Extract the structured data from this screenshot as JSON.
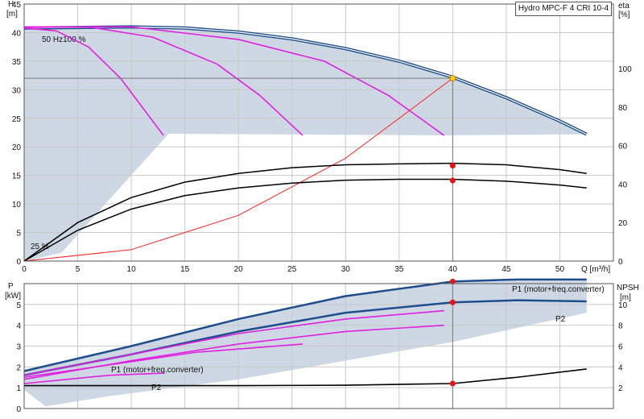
{
  "chart_data": [
    {
      "type": "line",
      "title": "Hydro MPC-F 4 CRI 10-4",
      "xlabel": "Q [m³/h]",
      "ylabel_unit": "H",
      "ylabel_bracket": "[m]",
      "y2label_unit": "eta",
      "y2label_bracket": "[%]",
      "xlim": [
        0,
        55
      ],
      "ylim": [
        0,
        45
      ],
      "y2lim": [
        0,
        133.5
      ],
      "x_ticks": [
        0,
        5,
        10,
        15,
        20,
        25,
        30,
        35,
        40,
        45,
        50
      ],
      "y_ticks": [
        0,
        5,
        10,
        15,
        20,
        25,
        30,
        35,
        40,
        45
      ],
      "y2_ticks": [
        0,
        20,
        40,
        60,
        80,
        100
      ],
      "grid": true,
      "annotations": [
        "50 Hz100 %",
        "25 %"
      ],
      "duty_point": {
        "x": 40,
        "y": 32
      },
      "series": [
        {
          "color": "#1f4e8c",
          "x": [
            0,
            5,
            10,
            15,
            20,
            25,
            30,
            35,
            40,
            45,
            50,
            52.5
          ],
          "y": [
            40.8,
            40.9,
            41,
            40.8,
            40.1,
            38.9,
            37.2,
            35,
            32.2,
            28.6,
            24.5,
            22.2
          ]
        },
        {
          "color": "#e020e0",
          "x": [
            0,
            3,
            6,
            9,
            11,
            13
          ],
          "y": [
            40.8,
            40.3,
            37.5,
            32,
            27,
            22
          ]
        },
        {
          "color": "#e020e0",
          "x": [
            0,
            6,
            12,
            18,
            22,
            26
          ],
          "y": [
            40.9,
            41,
            39.2,
            34.5,
            29,
            22
          ]
        },
        {
          "color": "#e020e0",
          "x": [
            0,
            10,
            20,
            28,
            34,
            39.2
          ],
          "y": [
            41,
            41,
            38.8,
            35,
            29,
            22
          ]
        },
        {
          "color": "#ff2020",
          "x": [
            0,
            10,
            20,
            30,
            40
          ],
          "y": [
            0,
            2,
            8,
            18,
            32
          ]
        },
        {
          "color": "#000000",
          "x": [
            0,
            5,
            10,
            15,
            20,
            25,
            30,
            35,
            40,
            45,
            50,
            52.5
          ],
          "y": [
            0,
            20,
            33,
            41,
            45.5,
            48.5,
            50,
            50.5,
            50.8,
            50,
            47.5,
            45.5
          ]
        },
        {
          "color": "#000000",
          "x": [
            0,
            5,
            10,
            15,
            20,
            25,
            30,
            35,
            40,
            45,
            50,
            52.5
          ],
          "y": [
            0,
            16,
            27,
            34,
            38,
            40.5,
            42,
            42.5,
            42.5,
            41.5,
            39.5,
            38
          ]
        }
      ],
      "markers": [
        {
          "x": 40,
          "y": 16.7
        },
        {
          "x": 40,
          "y": 14.1
        }
      ]
    },
    {
      "type": "line",
      "xlabel": "",
      "ylabel_unit": "P",
      "ylabel_bracket": "[kW]",
      "y2label_unit": "NPSH",
      "y2label_bracket": "[m]",
      "xlim": [
        0,
        55
      ],
      "ylim": [
        0,
        6
      ],
      "y2lim": [
        0,
        12
      ],
      "y_ticks": [
        0,
        1,
        2,
        3,
        4,
        5
      ],
      "y2_ticks": [
        2,
        4,
        6,
        8,
        10
      ],
      "grid": true,
      "annotations": [
        "P1 (motor+freq.converter)",
        "P2",
        "P1 (motor+freq.converter)",
        "P2"
      ],
      "series": [
        {
          "color": "#1f4e8c",
          "x": [
            0,
            10,
            20,
            30,
            40,
            46,
            52.5
          ],
          "y": [
            1.8,
            3,
            4.3,
            5.4,
            6.1,
            6.2,
            6.2
          ]
        },
        {
          "color": "#1f4e8c",
          "x": [
            0,
            10,
            20,
            30,
            40,
            46,
            52.5
          ],
          "y": [
            1.6,
            2.6,
            3.7,
            4.6,
            5.1,
            5.2,
            5.15
          ]
        },
        {
          "color": "#e020e0",
          "x": [
            0,
            10,
            20,
            30,
            39.2
          ],
          "y": [
            1.6,
            2.6,
            3.6,
            4.3,
            4.7
          ]
        },
        {
          "color": "#e020e0",
          "x": [
            0,
            10,
            20,
            30,
            39.2
          ],
          "y": [
            1.4,
            2.3,
            3.1,
            3.7,
            4
          ]
        },
        {
          "color": "#e020e0",
          "x": [
            0,
            8,
            16,
            26
          ],
          "y": [
            1.5,
            2.1,
            2.7,
            3.1
          ]
        },
        {
          "color": "#e020e0",
          "x": [
            0,
            4,
            8,
            13
          ],
          "y": [
            1.2,
            1.4,
            1.6,
            1.7
          ]
        },
        {
          "color": "#000000",
          "x": [
            0,
            20,
            30,
            40,
            46,
            52.5
          ],
          "y": [
            1.1,
            1.1,
            1.12,
            1.2,
            1.5,
            1.9
          ]
        }
      ],
      "markers": [
        {
          "x": 40,
          "y": 6.1
        },
        {
          "x": 40,
          "y": 5.1
        },
        {
          "x": 40,
          "y": 1.2
        }
      ]
    }
  ]
}
